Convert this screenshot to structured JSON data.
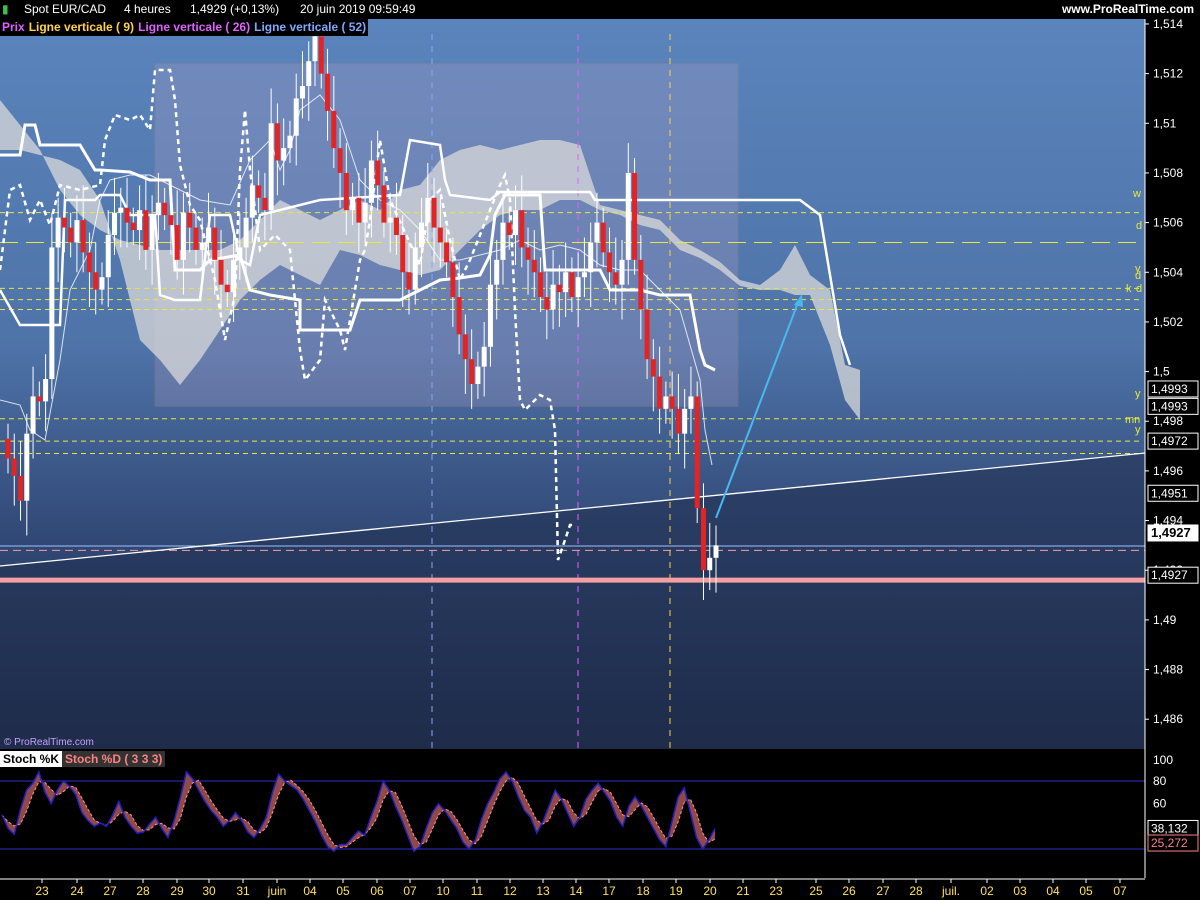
{
  "header": {
    "instrument": "Spot EUR/CAD",
    "timeframe": "4 heures",
    "quote": "1,4929 (+0,13%)",
    "datetime": "20 juin 2019 09:59:49",
    "site": "www.ProRealTime.com"
  },
  "legend": {
    "items": [
      {
        "label": "Prix",
        "color": "#e060ff"
      },
      {
        "label": "Ligne verticale ( 9)",
        "color": "#ffd24a"
      },
      {
        "label": "Ligne verticale ( 26)",
        "color": "#e060ff"
      },
      {
        "label": "Ligne verticale ( 52)",
        "color": "#7fa8ff"
      }
    ]
  },
  "copyright": "© ProRealTime.com",
  "colors": {
    "bg_top": "#5a82b8",
    "bg_bottom": "#1e2a48",
    "up_candle": "#ffffff",
    "down_candle": "#e32424",
    "support": "#f4a0a0",
    "level_line": "#e8e83a",
    "projection_arrow": "#4ab8f0",
    "stoch_k": "#2020c0",
    "stoch_d": "#ff9090",
    "stoch_fill": "#a05050"
  },
  "price_axis": {
    "ticks": [
      "1,514",
      "1,512",
      "1,51",
      "1,508",
      "1,506",
      "1,504",
      "1,502",
      "1,5",
      "1,498",
      "1,496",
      "1,494",
      "1,492",
      "1,49",
      "1,488",
      "1,486"
    ],
    "boxes": [
      {
        "label": "1,4993",
        "price": 1.4993,
        "style": "white"
      },
      {
        "label": "1,4993",
        "price": 1.4986,
        "style": "white"
      },
      {
        "label": "1,4972",
        "price": 1.4972,
        "style": "white"
      },
      {
        "label": "1,4951",
        "price": 1.4951,
        "style": "white"
      },
      {
        "label": "1,4927",
        "price": 1.4935,
        "style": "highlight"
      },
      {
        "label": "1,4927",
        "price": 1.4918,
        "style": "white"
      }
    ]
  },
  "levels": [
    {
      "label": "w",
      "price": 1.5064
    },
    {
      "label": "d",
      "price": 1.5052
    },
    {
      "label": "y",
      "price": 1.50335
    },
    {
      "label": "d",
      "price": 1.5029
    },
    {
      "label": "k",
      "price": 1.5025
    },
    {
      "label": "d",
      "price": 1.5025
    },
    {
      "label": "y",
      "price": 1.4981
    },
    {
      "label": "mn",
      "price": 1.4972
    },
    {
      "label": "y",
      "price": 1.4967
    }
  ],
  "sub_panel": {
    "title_k": "Stoch %K",
    "title_d": "Stoch %D ( 3 3 3)",
    "ticks": [
      "100",
      "80",
      "60"
    ],
    "k_value": "38,132",
    "d_value": "25,272"
  },
  "time_axis": {
    "labels": [
      "23",
      "24",
      "27",
      "28",
      "29",
      "30",
      "31",
      "juin",
      "04",
      "05",
      "06",
      "07",
      "10",
      "11",
      "12",
      "13",
      "14",
      "17",
      "18",
      "19",
      "20",
      "21",
      "23",
      "25",
      "26",
      "27",
      "28",
      "juil.",
      "02",
      "03",
      "04",
      "05",
      "07"
    ]
  },
  "chart_data": {
    "type": "candlestick",
    "title": "Spot EUR/CAD",
    "ylim": [
      1.4848,
      1.5142
    ],
    "price_ticks": [
      1.514,
      1.512,
      1.51,
      1.508,
      1.506,
      1.504,
      1.502,
      1.5,
      1.498,
      1.496,
      1.494,
      1.492,
      1.49,
      1.488,
      1.486
    ],
    "x_categories": [
      "23",
      "24",
      "27",
      "28",
      "29",
      "30",
      "31",
      "juin",
      "04",
      "05",
      "06",
      "07",
      "10",
      "11",
      "12",
      "13",
      "14",
      "17",
      "18",
      "19",
      "20",
      "21",
      "23",
      "25",
      "26",
      "27",
      "28",
      "juil.",
      "02",
      "03",
      "04",
      "05",
      "07"
    ],
    "last_price": 1.4929,
    "support_level": 1.4916,
    "current_price_line": 1.4928,
    "candles_close": [
      1.4965,
      1.4958,
      1.4948,
      1.4975,
      1.499,
      1.4988,
      1.4997,
      1.505,
      1.5062,
      1.5058,
      1.5052,
      1.5061,
      1.5048,
      1.504,
      1.5033,
      1.5038,
      1.5055,
      1.5064,
      1.5066,
      1.506,
      1.5057,
      1.5065,
      1.5049,
      1.5063,
      1.5068,
      1.5063,
      1.5059,
      1.5045,
      1.5064,
      1.5058,
      1.5049,
      1.5052,
      1.5058,
      1.5045,
      1.5035,
      1.5032,
      1.5045,
      1.505,
      1.5062,
      1.5075,
      1.507,
      1.5065,
      1.51,
      1.5085,
      1.509,
      1.5095,
      1.511,
      1.5115,
      1.5125,
      1.5135,
      1.512,
      1.5105,
      1.509,
      1.508,
      1.5065,
      1.507,
      1.506,
      1.5068,
      1.5085,
      1.5075,
      1.506,
      1.5062,
      1.5055,
      1.504,
      1.5033,
      1.505,
      1.506,
      1.507,
      1.5058,
      1.5052,
      1.5044,
      1.503,
      1.5015,
      1.5005,
      1.4995,
      1.5002,
      1.501,
      1.5035,
      1.5045,
      1.506,
      1.5055,
      1.5065,
      1.505,
      1.5045,
      1.504,
      1.503,
      1.5025,
      1.5035,
      1.5032,
      1.504,
      1.503,
      1.5038,
      1.504,
      1.5052,
      1.506,
      1.5048,
      1.504,
      1.5035,
      1.5045,
      1.508,
      1.5045,
      1.5025,
      1.5005,
      1.4998,
      1.4985,
      1.499,
      1.4985,
      1.4975,
      1.4985,
      1.499,
      1.4945,
      1.492,
      1.4925,
      1.493
    ],
    "cloud": {
      "top_approx": [
        1.51,
        1.5045
      ],
      "bottom_approx": [
        1.5015,
        1.497
      ]
    },
    "ref_lines": {
      "w": 1.5064,
      "d": 1.5052,
      "y": [
        1.50335,
        1.4981,
        1.4967
      ],
      "mn": 1.4972,
      "k": 1.5025
    },
    "rectangle_zone": {
      "price_top": 1.5124,
      "price_bottom": 1.4986
    },
    "stochastic": {
      "k_last": 38.132,
      "d_last": 25.272,
      "levels": [
        80,
        20
      ],
      "k": [
        50,
        38,
        33,
        55,
        72,
        78,
        88,
        70,
        60,
        72,
        80,
        75,
        68,
        52,
        45,
        40,
        43,
        40,
        50,
        62,
        48,
        40,
        34,
        35,
        42,
        48,
        38,
        30,
        45,
        65,
        88,
        82,
        72,
        62,
        54,
        48,
        40,
        45,
        52,
        45,
        35,
        30,
        38,
        48,
        70,
        86,
        80,
        76,
        72,
        64,
        54,
        44,
        32,
        22,
        18,
        24,
        24,
        30,
        36,
        32,
        48,
        62,
        80,
        72,
        58,
        46,
        32,
        18,
        22,
        38,
        52,
        60,
        54,
        46,
        38,
        26,
        20,
        28,
        46,
        60,
        70,
        82,
        88,
        80,
        66,
        54,
        48,
        34,
        44,
        58,
        72,
        64,
        52,
        40,
        48,
        64,
        72,
        78,
        70,
        62,
        48,
        40,
        58,
        66,
        58,
        48,
        38,
        28,
        22,
        44,
        66,
        74,
        52,
        30,
        20,
        28,
        38
      ]
    }
  }
}
